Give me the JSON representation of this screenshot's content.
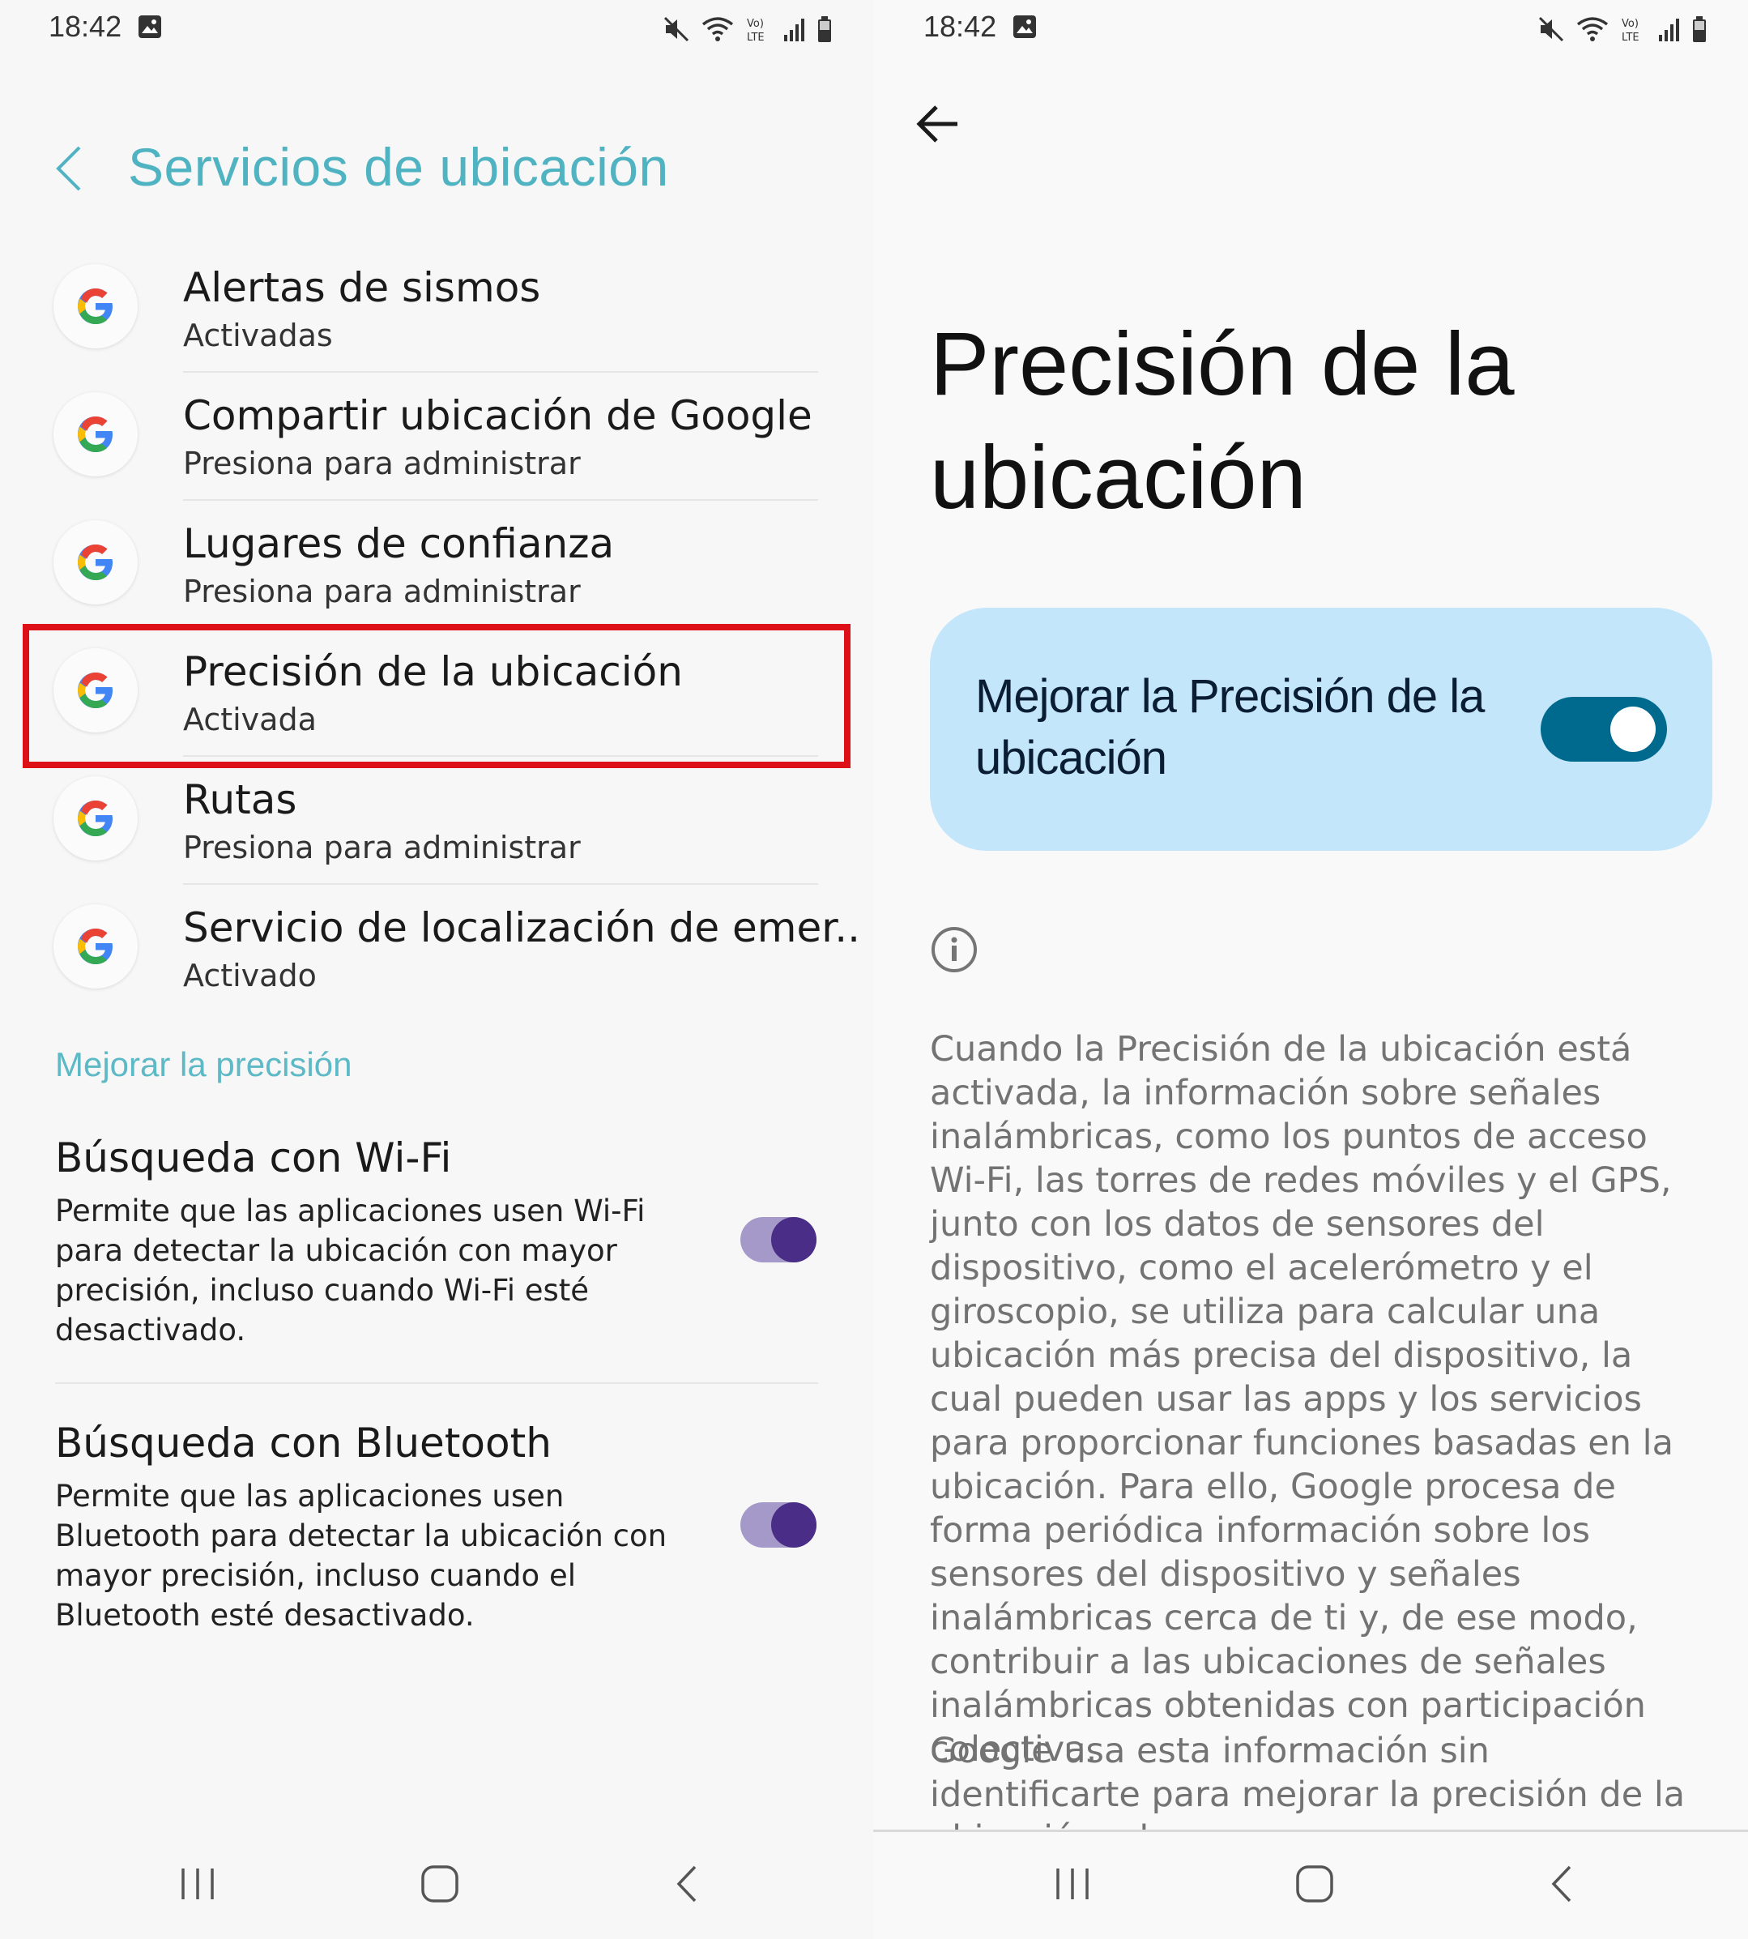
{
  "left": {
    "status": {
      "time": "18:42"
    },
    "header": {
      "title": "Servicios de ubicación"
    },
    "items": [
      {
        "title": "Alertas de sismos",
        "subtitle": "Activadas"
      },
      {
        "title": "Compartir ubicación de Google",
        "subtitle": "Presiona para administrar"
      },
      {
        "title": "Lugares de confianza",
        "subtitle": "Presiona para administrar"
      },
      {
        "title": "Precisión de la ubicación",
        "subtitle": "Activada"
      },
      {
        "title": "Rutas",
        "subtitle": "Presiona para administrar"
      },
      {
        "title": "Servicio de localización de emer..",
        "subtitle": "Activado"
      }
    ],
    "section_label": "Mejorar la precisión",
    "settings": [
      {
        "title": "Búsqueda con Wi-Fi",
        "description": "Permite que las aplicaciones usen Wi-Fi para detectar la ubicación con mayor precisión, incluso cuando Wi-Fi esté desactivado.",
        "enabled": true
      },
      {
        "title": "Búsqueda con Bluetooth",
        "description": "Permite que las aplicaciones usen Bluetooth para detectar la ubicación con mayor precisión, incluso cuando el Bluetooth esté desactivado.",
        "enabled": true
      }
    ]
  },
  "right": {
    "status": {
      "time": "18:42"
    },
    "title": "Precisión de la ubicación",
    "toggle_card": {
      "label": "Mejorar la Precisión de la ubicación",
      "enabled": true
    },
    "paragraph1": "Cuando la Precisión de la ubicación está activada, la información sobre señales inalámbricas, como los puntos de acceso Wi-Fi, las torres de redes móviles y el GPS, junto con los datos de sensores del dispositivo, como el acelerómetro y el giroscopio, se utiliza para calcular una ubicación más precisa del dispositivo, la cual pueden usar las apps y los servicios para proporcionar funciones basadas en la ubicación. Para ello, Google procesa de forma periódica información sobre los sensores del dispositivo y señales inalámbricas cerca de ti y, de ese modo, contribuir a las ubicaciones de señales inalámbricas obtenidas con participación colectiva.",
    "paragraph2": "Google usa esta información sin identificarte para mejorar la precisión de la ubicación y los"
  },
  "colors": {
    "accent_teal": "#4fb3c1",
    "highlight_red": "#dd0f17",
    "switch_purple": "#4a2d86",
    "card_blue": "#c3e6fb",
    "switch_blue": "#006a8e"
  },
  "icons": [
    "image-icon",
    "mute-icon",
    "wifi-icon",
    "volte-icon",
    "signal-icon",
    "battery-icon",
    "back-chevron-icon",
    "google-g-icon",
    "back-arrow-icon",
    "info-icon",
    "recents-icon",
    "home-icon",
    "nav-back-icon"
  ]
}
